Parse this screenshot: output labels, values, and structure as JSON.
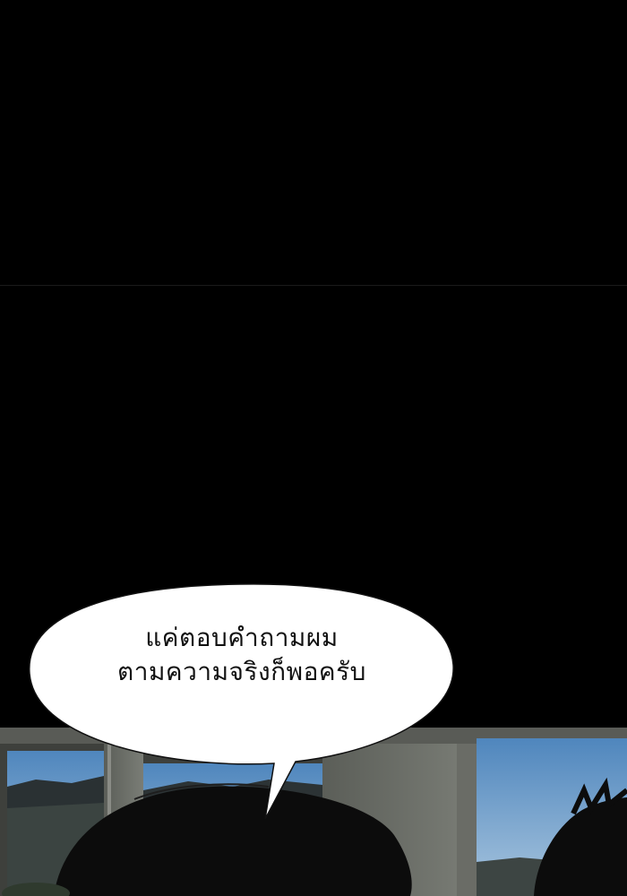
{
  "speech_bubble": {
    "line1": "แค่ตอบคำถามผม",
    "line2": "ตามความจริงก็พอครับ"
  },
  "colors": {
    "background": "#000000",
    "bubble_fill": "#ffffff",
    "bubble_text": "#111111",
    "sky": "#6f9fcf"
  }
}
